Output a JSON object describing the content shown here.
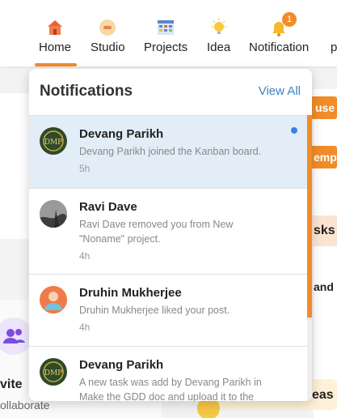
{
  "nav": {
    "items": [
      {
        "label": "Home",
        "icon": "home-icon"
      },
      {
        "label": "Studio",
        "icon": "studio-icon"
      },
      {
        "label": "Projects",
        "icon": "projects-icon"
      },
      {
        "label": "Idea",
        "icon": "bulb-icon"
      },
      {
        "label": "Notification",
        "icon": "bell-icon"
      }
    ],
    "notification_badge": "1",
    "overflow_label": "p"
  },
  "background": {
    "btn_use": "use",
    "btn_temp": "emp",
    "tasks_label": "sks",
    "and_label": "and",
    "invite_label": "vite",
    "collaborate_label": "ollaborate",
    "ideas_label": "eas"
  },
  "notifications": {
    "title": "Notifications",
    "view_all": "View All",
    "items": [
      {
        "name": "Devang Parikh",
        "message": "Devang Parikh joined the Kanban board.",
        "time": "5h",
        "unread": true,
        "avatar": "dmp"
      },
      {
        "name": "Ravi Dave",
        "message": "Ravi Dave removed you from New \"Noname\" project.",
        "time": "4h",
        "unread": false,
        "avatar": "photo"
      },
      {
        "name": "Druhin Mukherjee",
        "message": "Druhin Mukherjee liked your post.",
        "time": "4h",
        "unread": false,
        "avatar": "person"
      },
      {
        "name": "Devang Parikh",
        "message": "A new task was add by Devang Parikh in Make the GDD doc and upload it to the document…",
        "time": "",
        "unread": false,
        "avatar": "dmp"
      }
    ]
  },
  "colors": {
    "accent": "#f28c28",
    "link": "#3b82c4",
    "unread_bg": "#e3edf7"
  }
}
